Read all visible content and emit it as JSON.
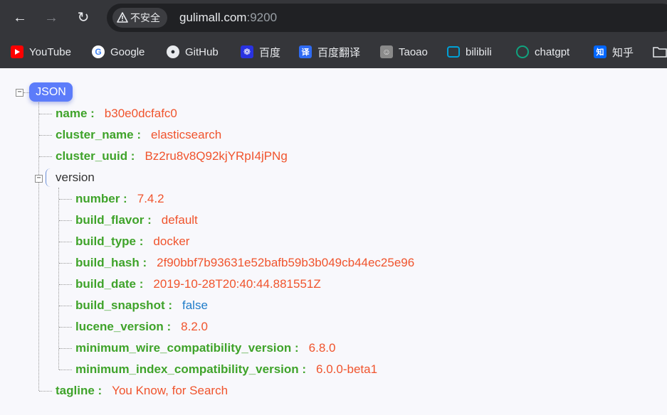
{
  "browser": {
    "security_label": "不安全",
    "url_host": "gulimall.com",
    "url_port": ":9200"
  },
  "bookmarks": [
    {
      "label": "YouTube",
      "icon": "youtube-icon",
      "color": "#ff0000"
    },
    {
      "label": "Google",
      "icon": "google-icon",
      "color": "#4285f4"
    },
    {
      "label": "GitHub",
      "icon": "github-icon",
      "color": "#e8eaed"
    },
    {
      "label": "百度",
      "icon": "baidu-icon",
      "color": "#2932e1"
    },
    {
      "label": "百度翻译",
      "icon": "baidu-translate-icon",
      "color": "#2f6bf3"
    },
    {
      "label": "Taoao",
      "icon": "taoao-avatar-icon",
      "color": "#8a8a8a"
    },
    {
      "label": "bilibili",
      "icon": "bilibili-icon",
      "color": "#00a1d6"
    },
    {
      "label": "chatgpt",
      "icon": "chatgpt-icon",
      "color": "#10a37f"
    },
    {
      "label": "知乎",
      "icon": "zhihu-icon",
      "color": "#0066ff"
    }
  ],
  "viewer": {
    "root_label": "JSON",
    "name_key": "name :",
    "name_val": "b30e0dcfafc0",
    "cluster_name_key": "cluster_name :",
    "cluster_name_val": "elasticsearch",
    "cluster_uuid_key": "cluster_uuid :",
    "cluster_uuid_val": "Bz2ru8v8Q92kjYRpI4jPNg",
    "version_key": "version",
    "number_key": "number :",
    "number_val": "7.4.2",
    "build_flavor_key": "build_flavor :",
    "build_flavor_val": "default",
    "build_type_key": "build_type :",
    "build_type_val": "docker",
    "build_hash_key": "build_hash :",
    "build_hash_val": "2f90bbf7b93631e52bafb59b3b049cb44ec25e96",
    "build_date_key": "build_date :",
    "build_date_val": "2019-10-28T20:40:44.881551Z",
    "build_snapshot_key": "build_snapshot :",
    "build_snapshot_val": "false",
    "lucene_version_key": "lucene_version :",
    "lucene_version_val": "8.2.0",
    "min_wire_key": "minimum_wire_compatibility_version :",
    "min_wire_val": "6.8.0",
    "min_index_key": "minimum_index_compatibility_version :",
    "min_index_val": "6.0.0-beta1",
    "tagline_key": "tagline :",
    "tagline_val": "You Know, for Search"
  }
}
